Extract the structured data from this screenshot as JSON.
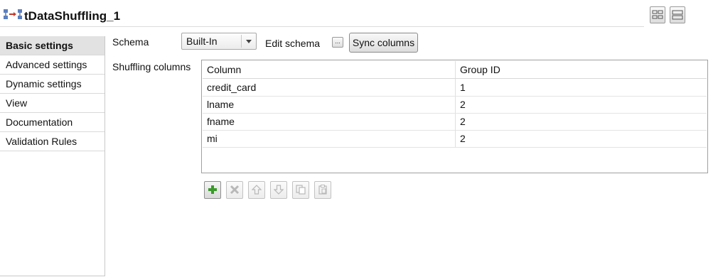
{
  "header": {
    "title": "tDataShuffling_1",
    "component_icon": "shuffle-component-icon",
    "layout_buttons": [
      "grid-layout-icon",
      "stacked-layout-icon"
    ]
  },
  "sidebar": {
    "items": [
      {
        "label": "Basic settings",
        "active": true
      },
      {
        "label": "Advanced settings",
        "active": false
      },
      {
        "label": "Dynamic settings",
        "active": false
      },
      {
        "label": "View",
        "active": false
      },
      {
        "label": "Documentation",
        "active": false
      },
      {
        "label": "Validation Rules",
        "active": false
      }
    ]
  },
  "schema": {
    "label": "Schema",
    "value": "Built-In",
    "edit_label": "Edit schema",
    "edit_button": "...",
    "sync_label": "Sync columns"
  },
  "shuffling": {
    "label": "Shuffling columns",
    "headers": [
      "Column",
      "Group ID"
    ],
    "rows": [
      [
        "credit_card",
        "1"
      ],
      [
        "lname",
        "2"
      ],
      [
        "fname",
        "2"
      ],
      [
        "mi",
        "2"
      ]
    ]
  },
  "toolbar": {
    "buttons": [
      {
        "icon": "add-icon",
        "enabled": true
      },
      {
        "icon": "delete-icon",
        "enabled": false
      },
      {
        "icon": "move-up-icon",
        "enabled": false
      },
      {
        "icon": "move-down-icon",
        "enabled": false
      },
      {
        "icon": "copy-icon",
        "enabled": false
      },
      {
        "icon": "paste-icon",
        "enabled": false
      }
    ]
  },
  "colors": {
    "active_tab_bg": "#e2e2e2",
    "add_icon": "#3a9a2a",
    "disabled_icon": "#b8b8b8"
  }
}
